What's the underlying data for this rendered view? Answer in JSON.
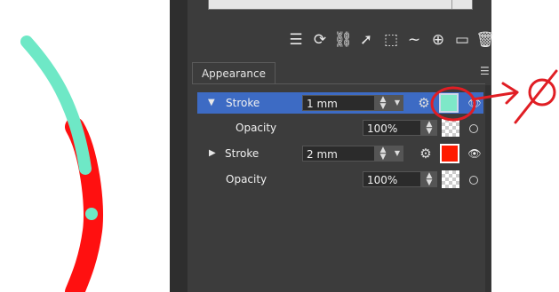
{
  "canvas": {
    "green_stroke_color": "#6ee8c6",
    "red_stroke_color": "#ff1010"
  },
  "toolbar": {
    "icons": [
      "sliders-icon",
      "rotate-icon",
      "link-icon",
      "select-cursor-icon",
      "crop-icon",
      "wave-icon",
      "plus-circle-icon",
      "rectangle-icon",
      "trash-icon"
    ]
  },
  "panel": {
    "tab_label": "Appearance",
    "rows": [
      {
        "label": "Stroke",
        "value": "1 mm",
        "swatch_color": "#7ee8c8",
        "selected": true,
        "expanded": true
      },
      {
        "label": "Opacity",
        "value": "100%"
      },
      {
        "label": "Stroke",
        "value": "2 mm",
        "swatch_color": "#ff1a00",
        "selected": false,
        "expanded": false
      },
      {
        "label": "Opacity",
        "value": "100%"
      }
    ]
  },
  "colors": {
    "panel_bg": "#3c3c3c",
    "selection": "#3d6bc4",
    "annotation_red": "#e01e24"
  }
}
